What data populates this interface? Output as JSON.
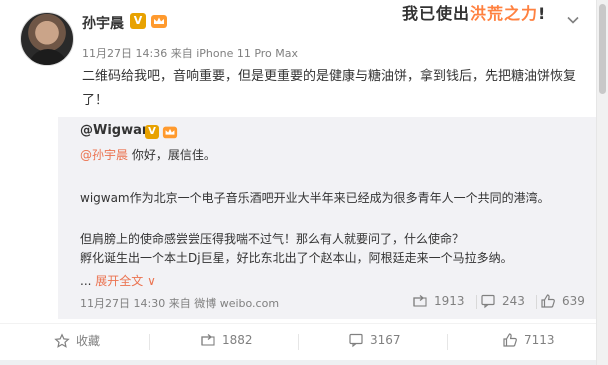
{
  "author": {
    "name": "孙宇晨",
    "badge": "V",
    "timestamp": "11月27日 14:36",
    "source_prefix": "来自",
    "source": "iPhone 11 Pro Max"
  },
  "banner": {
    "part1": "我已使出",
    "part2": "洪荒之力",
    "part3": "!"
  },
  "post": {
    "text": "二维码给我吧，音响重要，但是更重要的是健康与糖油饼，拿到钱后，先把糖油饼恢复了！"
  },
  "repost": {
    "author": "@Wigwam",
    "badge": "V",
    "mention": "@孙宇晨",
    "greeting": " 你好，展信佳。",
    "para1": "wigwam作为北京一个电子音乐酒吧开业大半年来已经成为很多青年人一个共同的港湾。",
    "para2": "但肩膀上的使命感尝尝压得我喘不过气！那么有人就要问了，什么使命？",
    "para3": "孵化诞生出一个本土Dj巨星，好比东北出了个赵本山，阿根廷走来一个马拉多纳。",
    "expand": "展开全文",
    "expand_arrow": "∨",
    "ellipsis": "...",
    "timestamp": "11月27日 14:30",
    "source_prefix": "来自",
    "source": "微博 weibo.com",
    "forwards": "1913",
    "comments": "243",
    "likes": "639"
  },
  "actions": {
    "favorite": "收藏",
    "forwards": "1882",
    "comments": "3167",
    "likes": "7113"
  },
  "colors": {
    "link": "#eb7350",
    "badge": "#e8a200",
    "meta": "#808080",
    "repost_bg": "#f2f2f5"
  }
}
